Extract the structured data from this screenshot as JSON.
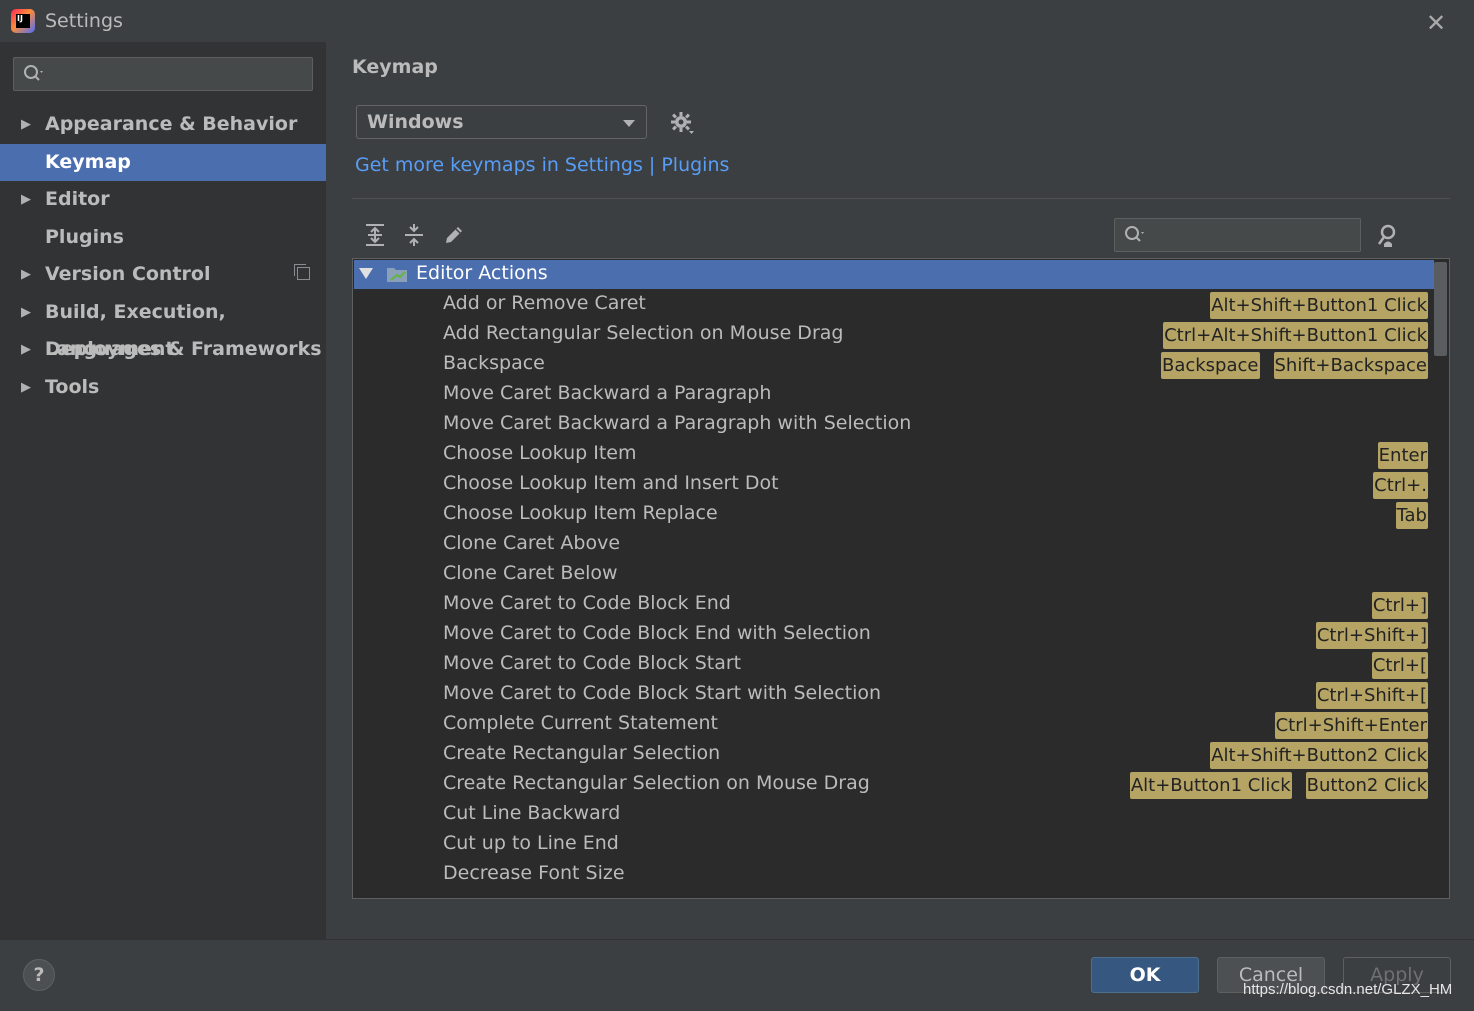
{
  "window": {
    "title": "Settings"
  },
  "sidebar": {
    "search_placeholder": "",
    "items": [
      {
        "label": "Appearance & Behavior",
        "expandable": true,
        "selected": false
      },
      {
        "label": "Keymap",
        "expandable": false,
        "selected": true
      },
      {
        "label": "Editor",
        "expandable": true,
        "selected": false
      },
      {
        "label": "Plugins",
        "expandable": false,
        "selected": false
      },
      {
        "label": "Version Control",
        "expandable": true,
        "selected": false
      },
      {
        "label": "Build, Execution, Deployment",
        "expandable": true,
        "selected": false
      },
      {
        "label": "Languages & Frameworks",
        "expandable": true,
        "selected": false
      },
      {
        "label": "Tools",
        "expandable": true,
        "selected": false
      }
    ]
  },
  "main": {
    "title": "Keymap",
    "keymap_value": "Windows",
    "link": "Get more keymaps in Settings | Plugins",
    "tree_search_placeholder": "",
    "group": {
      "name": "Editor Actions",
      "expanded": true
    },
    "actions": [
      {
        "name": "Add or Remove Caret",
        "shortcuts": [
          "Alt+Shift+Button1 Click"
        ]
      },
      {
        "name": "Add Rectangular Selection on Mouse Drag",
        "shortcuts": [
          "Ctrl+Alt+Shift+Button1 Click"
        ]
      },
      {
        "name": "Backspace",
        "shortcuts": [
          "Backspace",
          "Shift+Backspace"
        ]
      },
      {
        "name": "Move Caret Backward a Paragraph",
        "shortcuts": []
      },
      {
        "name": "Move Caret Backward a Paragraph with Selection",
        "shortcuts": []
      },
      {
        "name": "Choose Lookup Item",
        "shortcuts": [
          "Enter"
        ]
      },
      {
        "name": "Choose Lookup Item and Insert Dot",
        "shortcuts": [
          "Ctrl+."
        ]
      },
      {
        "name": "Choose Lookup Item Replace",
        "shortcuts": [
          "Tab"
        ]
      },
      {
        "name": "Clone Caret Above",
        "shortcuts": []
      },
      {
        "name": "Clone Caret Below",
        "shortcuts": []
      },
      {
        "name": "Move Caret to Code Block End",
        "shortcuts": [
          "Ctrl+]"
        ]
      },
      {
        "name": "Move Caret to Code Block End with Selection",
        "shortcuts": [
          "Ctrl+Shift+]"
        ]
      },
      {
        "name": "Move Caret to Code Block Start",
        "shortcuts": [
          "Ctrl+["
        ]
      },
      {
        "name": "Move Caret to Code Block Start with Selection",
        "shortcuts": [
          "Ctrl+Shift+["
        ]
      },
      {
        "name": "Complete Current Statement",
        "shortcuts": [
          "Ctrl+Shift+Enter"
        ]
      },
      {
        "name": "Create Rectangular Selection",
        "shortcuts": [
          "Alt+Shift+Button2 Click"
        ]
      },
      {
        "name": "Create Rectangular Selection on Mouse Drag",
        "shortcuts": [
          "Alt+Button1 Click",
          "Button2 Click"
        ]
      },
      {
        "name": "Cut Line Backward",
        "shortcuts": []
      },
      {
        "name": "Cut up to Line End",
        "shortcuts": []
      },
      {
        "name": "Decrease Font Size",
        "shortcuts": []
      }
    ]
  },
  "footer": {
    "help_label": "?",
    "ok_label": "OK",
    "cancel_label": "Cancel",
    "apply_label": "Apply"
  },
  "watermark": "https://blog.csdn.net/GLZX_HM",
  "colors": {
    "background": "#3c3f41",
    "sidebar": "#313335",
    "selection": "#4b6eaf",
    "link": "#589df6",
    "shortcut_badge": "#b5a464",
    "tree_background": "#2b2b2b"
  }
}
